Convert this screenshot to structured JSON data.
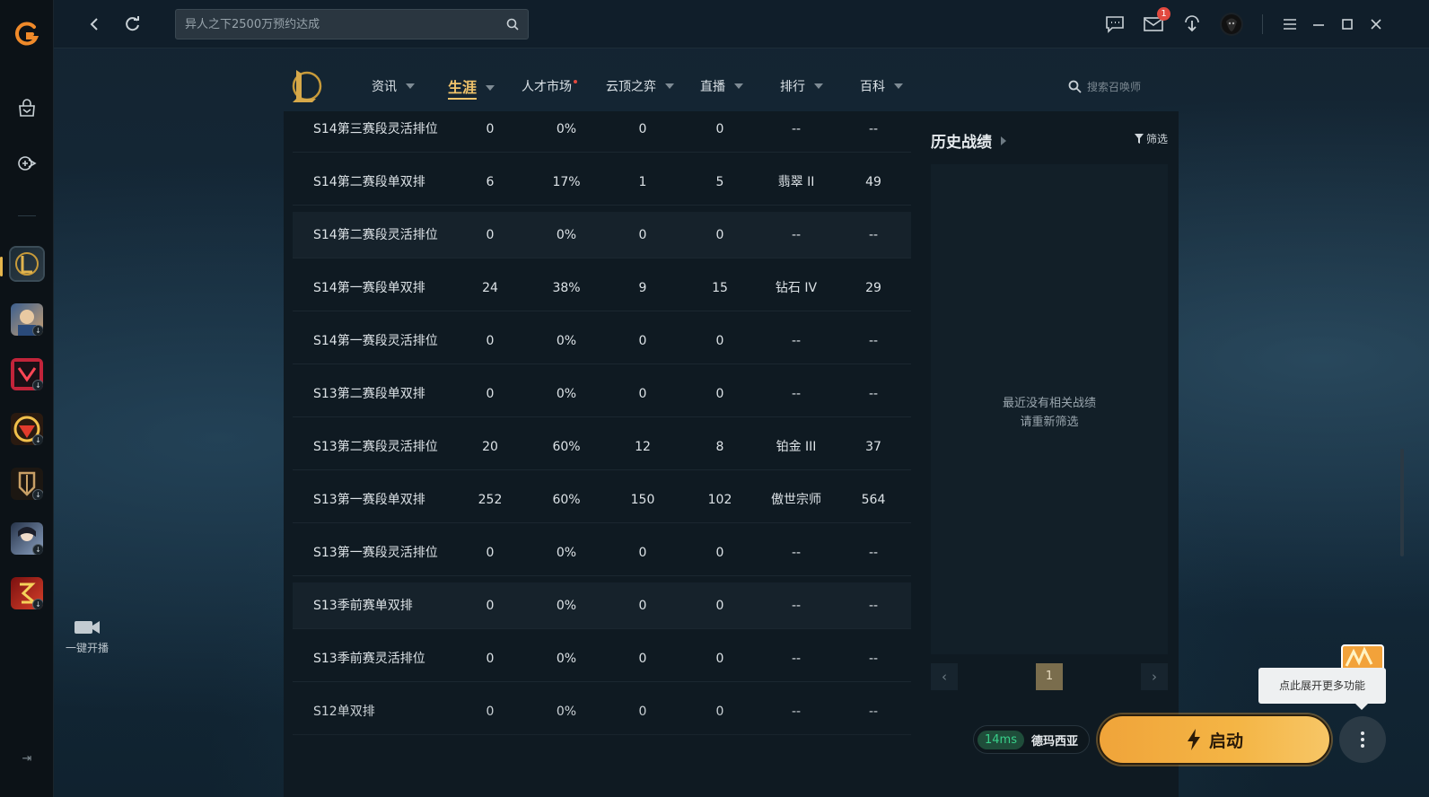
{
  "topbar": {
    "search_placeholder": "异人之下2500万预约达成",
    "mail_badge": "1"
  },
  "sidebar": {
    "stream_label": "一键开播",
    "games": [
      "英雄联盟",
      "game-2",
      "无畏契约",
      "穿越火线",
      "game-5",
      "game-6",
      "game-7"
    ]
  },
  "lol_nav": {
    "items": [
      {
        "label": "资讯",
        "caret": true
      },
      {
        "label": "生涯",
        "caret": true,
        "active": true
      },
      {
        "label": "人才市场",
        "caret": false,
        "dot": true
      },
      {
        "label": "云顶之弈",
        "caret": true
      },
      {
        "label": "直播",
        "caret": true
      },
      {
        "label": "排行",
        "caret": true
      },
      {
        "label": "百科",
        "caret": true
      }
    ],
    "search_placeholder": "搜索召唤师"
  },
  "rank_table": {
    "rows": [
      [
        "S14第三赛段灵活排位",
        "0",
        "0%",
        "0",
        "0",
        "--",
        "--"
      ],
      [
        "S14第二赛段单双排",
        "6",
        "17%",
        "1",
        "5",
        "翡翠 II",
        "49"
      ],
      [
        "S14第二赛段灵活排位",
        "0",
        "0%",
        "0",
        "0",
        "--",
        "--"
      ],
      [
        "S14第一赛段单双排",
        "24",
        "38%",
        "9",
        "15",
        "钻石 IV",
        "29"
      ],
      [
        "S14第一赛段灵活排位",
        "0",
        "0%",
        "0",
        "0",
        "--",
        "--"
      ],
      [
        "S13第二赛段单双排",
        "0",
        "0%",
        "0",
        "0",
        "--",
        "--"
      ],
      [
        "S13第二赛段灵活排位",
        "20",
        "60%",
        "12",
        "8",
        "铂金 III",
        "37"
      ],
      [
        "S13第一赛段单双排",
        "252",
        "60%",
        "150",
        "102",
        "傲世宗师",
        "564"
      ],
      [
        "S13第一赛段灵活排位",
        "0",
        "0%",
        "0",
        "0",
        "--",
        "--"
      ],
      [
        "S13季前赛单双排",
        "0",
        "0%",
        "0",
        "0",
        "--",
        "--"
      ],
      [
        "S13季前赛灵活排位",
        "0",
        "0%",
        "0",
        "0",
        "--",
        "--"
      ],
      [
        "S12单双排",
        "0",
        "0%",
        "0",
        "0",
        "--",
        "--"
      ]
    ],
    "highlight_rows": [
      2,
      9
    ]
  },
  "history": {
    "title": "历史战绩",
    "filter_label": "筛选",
    "empty_line1": "最近没有相关战绩",
    "empty_line2": "请重新筛选",
    "page": "1"
  },
  "launch": {
    "ping": "14ms",
    "server": "德玛西亚",
    "button_label": "启动",
    "tooltip": "点此展开更多功能"
  },
  "colors": {
    "accent_gold": "#f1c46b",
    "launch_orange": "#f4b545",
    "ping_green": "#38d08a",
    "badge_red": "#e2493f"
  }
}
